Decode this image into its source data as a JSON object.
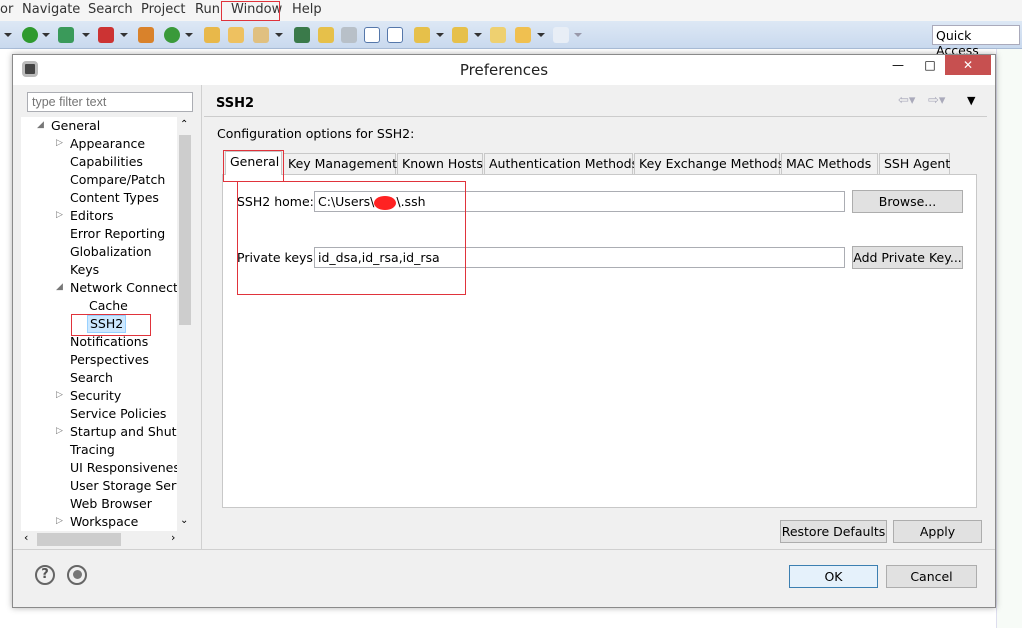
{
  "menubar": {
    "items": [
      "or",
      "Navigate",
      "Search",
      "Project",
      "Run",
      "Window",
      "Help"
    ]
  },
  "toolbar": {
    "quick_access": "Quick Access"
  },
  "dialog": {
    "title": "Preferences",
    "filter_placeholder": "type filter text",
    "tree": [
      {
        "label": "General",
        "level": 0,
        "expander": "expanded"
      },
      {
        "label": "Appearance",
        "level": 1,
        "expander": "collapsed"
      },
      {
        "label": "Capabilities",
        "level": 1
      },
      {
        "label": "Compare/Patch",
        "level": 1
      },
      {
        "label": "Content Types",
        "level": 1
      },
      {
        "label": "Editors",
        "level": 1,
        "expander": "collapsed"
      },
      {
        "label": "Error Reporting",
        "level": 1
      },
      {
        "label": "Globalization",
        "level": 1
      },
      {
        "label": "Keys",
        "level": 1
      },
      {
        "label": "Network Connections",
        "level": 1,
        "expander": "expanded"
      },
      {
        "label": "Cache",
        "level": 2
      },
      {
        "label": "SSH2",
        "level": 2,
        "selected": true
      },
      {
        "label": "Notifications",
        "level": 1
      },
      {
        "label": "Perspectives",
        "level": 1
      },
      {
        "label": "Search",
        "level": 1
      },
      {
        "label": "Security",
        "level": 1,
        "expander": "collapsed"
      },
      {
        "label": "Service Policies",
        "level": 1
      },
      {
        "label": "Startup and Shutdown",
        "level": 1,
        "expander": "collapsed"
      },
      {
        "label": "Tracing",
        "level": 1
      },
      {
        "label": "UI Responsiveness",
        "level": 1
      },
      {
        "label": "User Storage Service",
        "level": 1
      },
      {
        "label": "Web Browser",
        "level": 1
      },
      {
        "label": "Workspace",
        "level": 1,
        "expander": "collapsed"
      }
    ],
    "page_title": "SSH2",
    "description": "Configuration options for SSH2:",
    "tabs": [
      "General",
      "Key Management",
      "Known Hosts",
      "Authentication Methods",
      "Key Exchange Methods",
      "MAC Methods",
      "SSH Agent"
    ],
    "active_tab": "General",
    "ssh2_home_label": "SSH2 home:",
    "ssh2_home_prefix": "C:\\Users\\",
    "ssh2_home_suffix": "\\.ssh",
    "browse_label": "Browse...",
    "private_keys_label": "Private keys:",
    "private_keys_value": "id_dsa,id_rsa,id_rsa",
    "add_private_key_label": "Add Private Key...",
    "restore_defaults_label": "Restore Defaults",
    "apply_label": "Apply",
    "ok_label": "OK",
    "cancel_label": "Cancel",
    "help_icon": "?",
    "highlight_color": "#e0333b",
    "selection_color": "#cce8ff"
  }
}
